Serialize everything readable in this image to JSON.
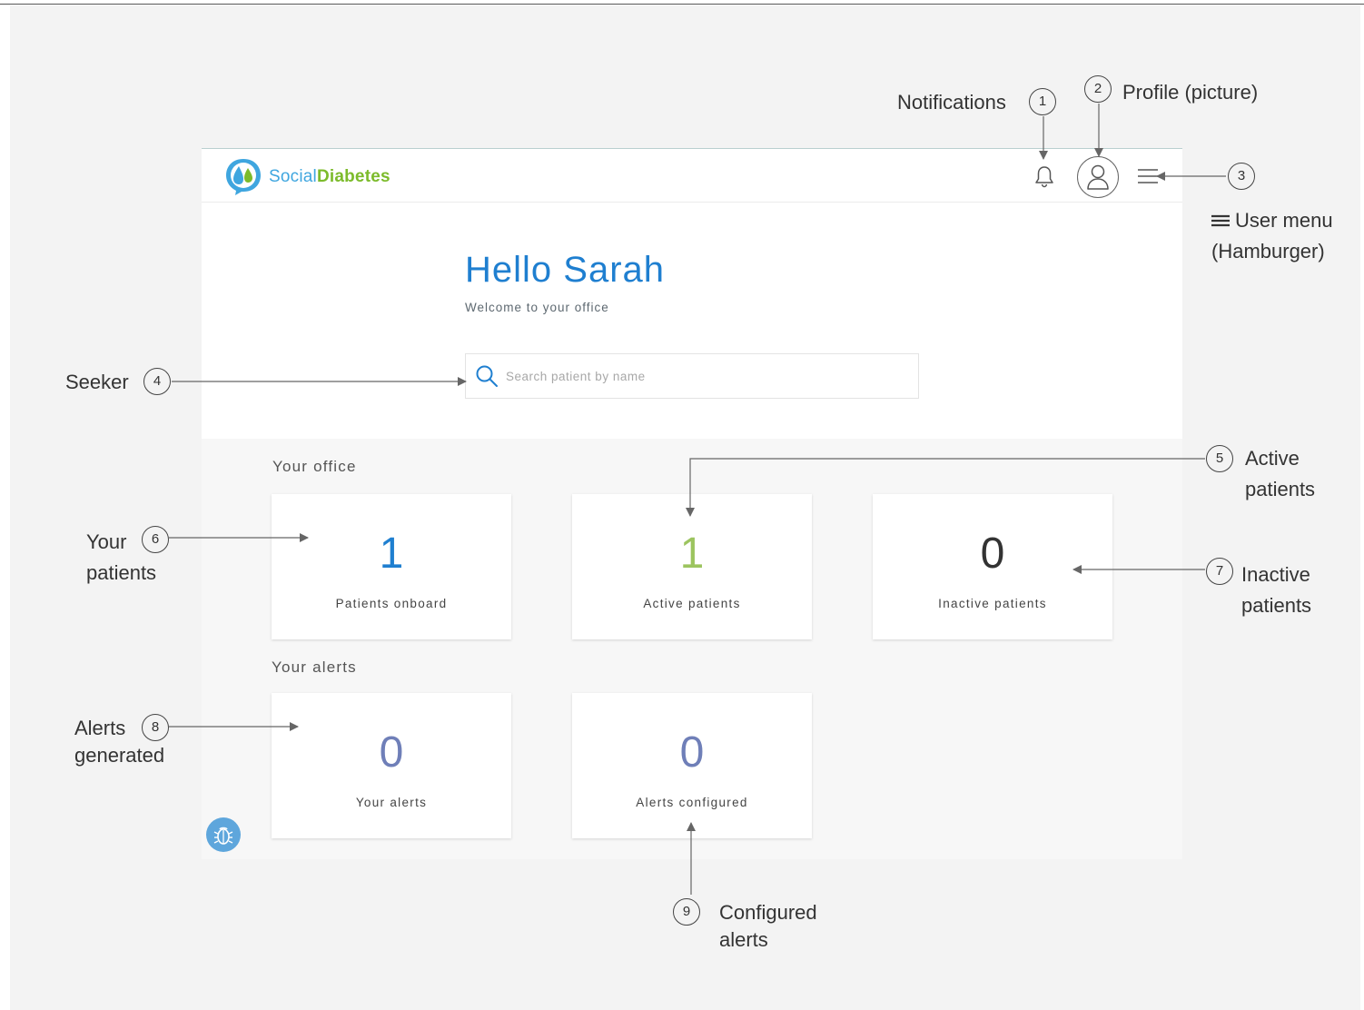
{
  "app": {
    "brand_part1": "Social",
    "brand_part2": "Diabetes",
    "colors": {
      "brand_blue": "#3fa6df",
      "brand_green": "#7cbb2b",
      "title_blue": "#1f7fd0"
    }
  },
  "navbar": {
    "icons": [
      "bell-icon",
      "user-avatar-icon",
      "hamburger-menu-icon"
    ]
  },
  "hero": {
    "greeting": "Hello Sarah",
    "subtitle": "Welcome to your office",
    "search": {
      "placeholder": "Search patient by name",
      "value": ""
    }
  },
  "office": {
    "title": "Your office",
    "cards": [
      {
        "value": "1",
        "label": "Patients onboard",
        "color": "#1f7fd0"
      },
      {
        "value": "1",
        "label": "Active patients",
        "color": "#9cc45f"
      },
      {
        "value": "0",
        "label": "Inactive patients",
        "color": "#333333"
      }
    ]
  },
  "alerts": {
    "title": "Your alerts",
    "cards": [
      {
        "value": "0",
        "label": "Your alerts",
        "color": "#6f7fb8"
      },
      {
        "value": "0",
        "label": "Alerts configured",
        "color": "#6f7fb8"
      }
    ]
  },
  "annotations": [
    {
      "num": "1",
      "text": "Notifications"
    },
    {
      "num": "2",
      "text": "Profile (picture)"
    },
    {
      "num": "3",
      "line1": "User menu",
      "line2": "(Hamburger)"
    },
    {
      "num": "4",
      "text": "Seeker"
    },
    {
      "num": "5",
      "line1": "Active",
      "line2": "patients"
    },
    {
      "num": "6",
      "line1": "Your",
      "line2": "patients"
    },
    {
      "num": "7",
      "line1": "Inactive",
      "line2": "patients"
    },
    {
      "num": "8",
      "line1": "Alerts",
      "line2": "generated"
    },
    {
      "num": "9",
      "line1": "Configured",
      "line2": "alerts"
    }
  ]
}
